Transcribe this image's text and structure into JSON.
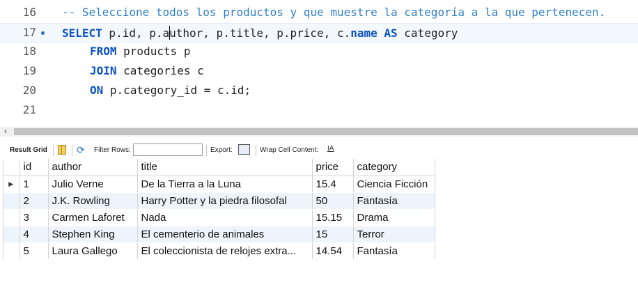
{
  "editor": {
    "lines": [
      {
        "num": "16",
        "text": "-- Seleccione todos los productos y que muestre la categoría a la que pertenecen."
      },
      {
        "num": "17",
        "kw1": "SELECT",
        "t1": " p.id, p.a",
        "t2": "uthor, p.title, p.price, c.",
        "kw2": "name",
        "sp": " ",
        "kw3": "AS",
        "t3": " category"
      },
      {
        "num": "18",
        "kw": "FROM",
        "text": " products p"
      },
      {
        "num": "19",
        "kw": "JOIN",
        "text": " categories c"
      },
      {
        "num": "20",
        "kw": "ON",
        "text": " p.category_id = c.id;"
      },
      {
        "num": "21"
      }
    ]
  },
  "toolbar": {
    "result_grid": "Result Grid",
    "filter_rows": "Filter Rows:",
    "filter_value": "",
    "export": "Export:",
    "wrap": "Wrap Cell Content:",
    "wrap_icon": "IA"
  },
  "grid": {
    "columns": [
      "id",
      "author",
      "title",
      "price",
      "category"
    ],
    "rows": [
      [
        "1",
        "Julio Verne",
        "De la Tierra a la Luna",
        "15.4",
        "Ciencia Ficción"
      ],
      [
        "2",
        "J.K. Rowling",
        "Harry Potter y la piedra filosofal",
        "50",
        "Fantasía"
      ],
      [
        "3",
        "Carmen Laforet",
        "Nada",
        "15.15",
        "Drama"
      ],
      [
        "4",
        "Stephen King",
        "El cementerio de animales",
        "15",
        "Terror"
      ],
      [
        "5",
        "Laura Gallego",
        "El coleccionista de relojes extra...",
        "14.54",
        "Fantasía"
      ]
    ]
  },
  "icons": {
    "row_marker": "triangle-right-icon",
    "grid": "grid-icon",
    "refresh": "refresh-icon",
    "export": "export-icon",
    "wrap": "wrap-text-icon",
    "scroll_left": "chevron-left-icon"
  },
  "colors": {
    "keyword": "#0b52c4",
    "comment": "#2f7fc8",
    "alt_row": "#eef4fc"
  }
}
